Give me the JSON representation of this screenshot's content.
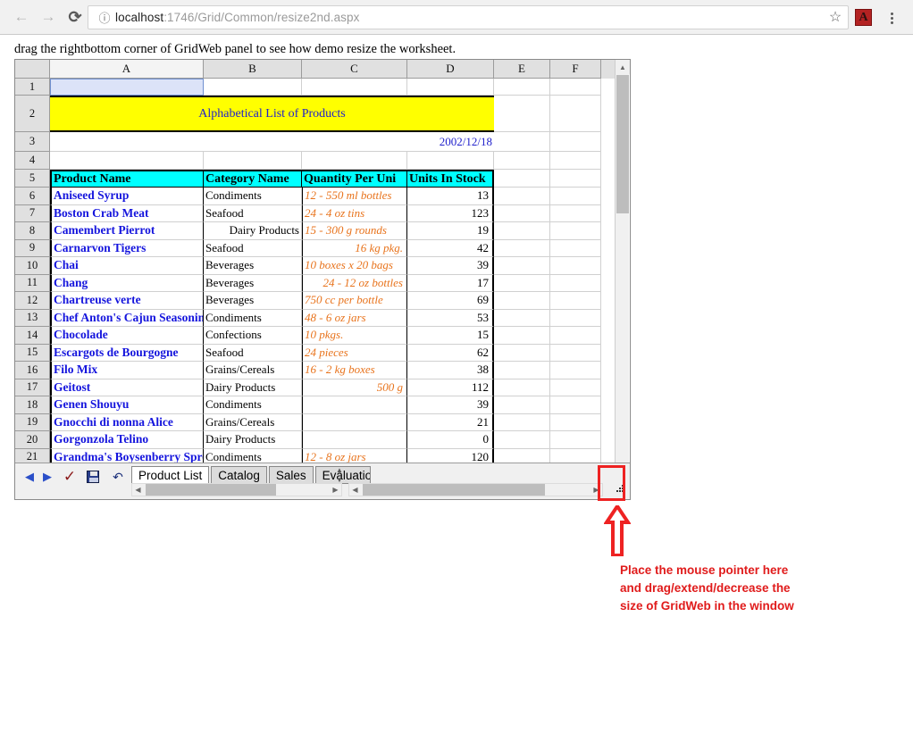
{
  "browser": {
    "back_icon": "back-arrow",
    "forward_icon": "forward-arrow",
    "reload_icon": "reload",
    "site_info_icon": "info-circle",
    "url_host": "localhost",
    "url_path": ":1746/Grid/Common/resize2nd.aspx",
    "bookmark_icon": "star",
    "pdf_extension_label": "A",
    "menu_icon": "three-dot-menu"
  },
  "page": {
    "instruction": "drag the rightbottom corner of GridWeb panel to see how demo resize the worksheet."
  },
  "grid": {
    "columns": [
      "A",
      "B",
      "C",
      "D",
      "E",
      "F"
    ],
    "active_column": "A",
    "selected_cell": "A1",
    "title_cell": "Alphabetical List of Products",
    "date_cell": "2002/12/18",
    "headers": [
      "Product Name",
      "Category Name",
      "Quantity Per Uni",
      "Units In Stock"
    ],
    "rows": [
      {
        "n": "6",
        "name": "Aniseed Syrup",
        "cat": "Condiments",
        "cat_align": "left",
        "qty": "12 - 550 ml bottles",
        "qty_align": "left",
        "stock": "13"
      },
      {
        "n": "7",
        "name": "Boston Crab Meat",
        "cat": "Seafood",
        "cat_align": "left",
        "qty": "24 - 4 oz tins",
        "qty_align": "left",
        "stock": "123"
      },
      {
        "n": "8",
        "name": "Camembert Pierrot",
        "cat": "Dairy Products",
        "cat_align": "right",
        "qty": "15 - 300 g rounds",
        "qty_align": "left",
        "stock": "19"
      },
      {
        "n": "9",
        "name": "Carnarvon Tigers",
        "cat": "Seafood",
        "cat_align": "left",
        "qty": "16 kg pkg.",
        "qty_align": "right",
        "stock": "42"
      },
      {
        "n": "10",
        "name": "Chai",
        "cat": "Beverages",
        "cat_align": "left",
        "qty": "10 boxes x 20 bags",
        "qty_align": "left",
        "stock": "39"
      },
      {
        "n": "11",
        "name": "Chang",
        "cat": "Beverages",
        "cat_align": "left",
        "qty": "24 - 12 oz bottles",
        "qty_align": "right",
        "stock": "17"
      },
      {
        "n": "12",
        "name": "Chartreuse verte",
        "cat": "Beverages",
        "cat_align": "left",
        "qty": "750 cc per bottle",
        "qty_align": "left",
        "stock": "69"
      },
      {
        "n": "13",
        "name": "Chef Anton's Cajun Seasoning",
        "cat": "Condiments",
        "cat_align": "left",
        "qty": "48 - 6 oz jars",
        "qty_align": "left",
        "stock": "53"
      },
      {
        "n": "14",
        "name": "Chocolade",
        "cat": "Confections",
        "cat_align": "left",
        "qty": "10 pkgs.",
        "qty_align": "left",
        "stock": "15"
      },
      {
        "n": "15",
        "name": "Escargots de Bourgogne",
        "cat": "Seafood",
        "cat_align": "left",
        "qty": "24 pieces",
        "qty_align": "left",
        "stock": "62"
      },
      {
        "n": "16",
        "name": "Filo Mix",
        "cat": "Grains/Cereals",
        "cat_align": "left",
        "qty": "16 - 2 kg boxes",
        "qty_align": "left",
        "stock": "38"
      },
      {
        "n": "17",
        "name": "Geitost",
        "cat": "Dairy Products",
        "cat_align": "left",
        "qty": "500 g",
        "qty_align": "right",
        "stock": "112"
      },
      {
        "n": "18",
        "name": "Genen Shouyu",
        "cat": "Condiments",
        "cat_align": "left",
        "qty": "",
        "qty_align": "left",
        "stock": "39"
      },
      {
        "n": "19",
        "name": "Gnocchi di nonna Alice",
        "cat": "Grains/Cereals",
        "cat_align": "left",
        "qty": "",
        "qty_align": "left",
        "stock": "21"
      },
      {
        "n": "20",
        "name": "Gorgonzola Telino",
        "cat": "Dairy Products",
        "cat_align": "left",
        "qty": "",
        "qty_align": "left",
        "stock": "0"
      },
      {
        "n": "21",
        "name": "Grandma's Boysenberry Spread",
        "cat": "Condiments",
        "cat_align": "left",
        "qty": "12 - 8 oz jars",
        "qty_align": "left",
        "stock": "120"
      }
    ],
    "row_numbers_top": [
      "1",
      "2",
      "3",
      "4",
      "5"
    ]
  },
  "toolbar": {
    "prev_icon": "prev-arrow",
    "next_icon": "next-arrow",
    "commit_icon": "checkmark",
    "save_icon": "floppy-disk",
    "undo_icon": "undo-arrow",
    "tabs": [
      {
        "label": "Product List",
        "active": true
      },
      {
        "label": "Catalog",
        "active": false
      },
      {
        "label": "Sales",
        "active": false
      },
      {
        "label": "Evaluation",
        "active": false
      }
    ],
    "resize_handle_icon": "resize-grip"
  },
  "annotation": {
    "line1": "Place the mouse pointer here",
    "line2": "and drag/extend/decrease the",
    "line3": "size of GridWeb in the window",
    "color": "#e01b1b"
  }
}
